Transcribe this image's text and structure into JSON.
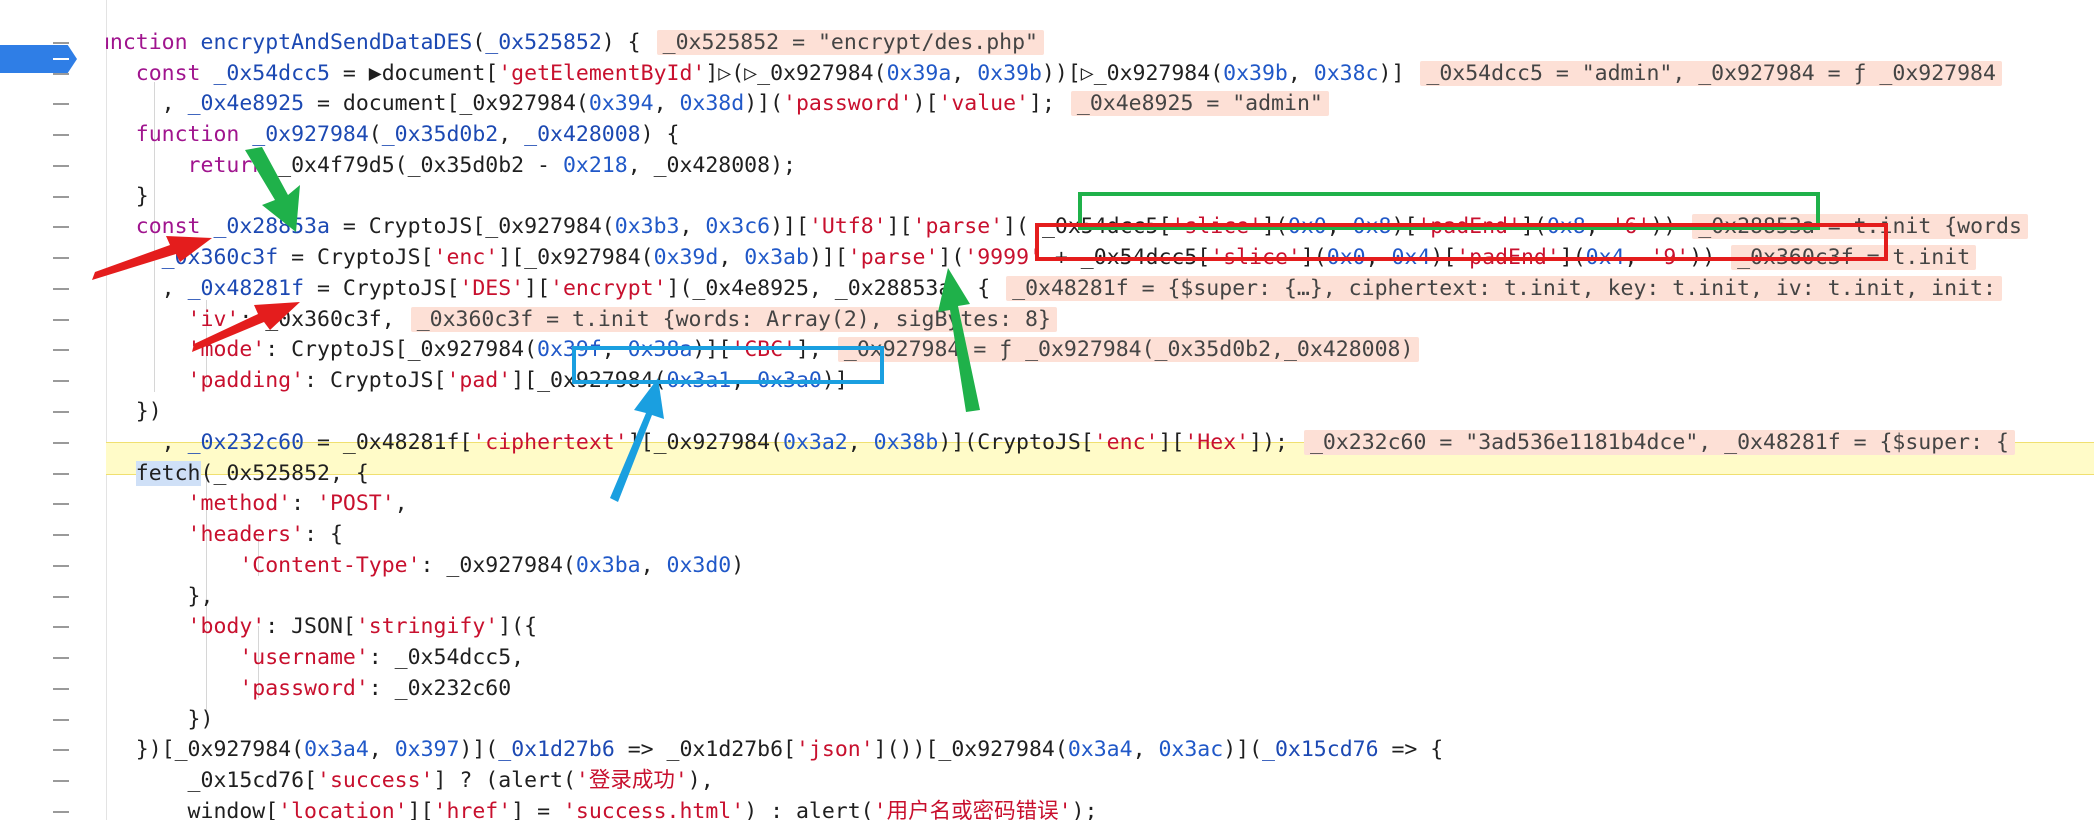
{
  "gutter": {
    "mark": "–"
  },
  "lines": [
    [
      {
        "c": "id",
        "t": "}"
      }
    ],
    [
      {
        "c": "kw",
        "t": "function "
      },
      {
        "c": "fn",
        "t": "encryptAndSendDataDES"
      },
      {
        "c": "pun",
        "t": "("
      },
      {
        "c": "fn",
        "t": "_0x525852"
      },
      {
        "c": "pun",
        "t": ") {"
      },
      {
        "c": "inl",
        "t": "_0x525852 = \"encrypt/des.php\""
      }
    ],
    [
      {
        "c": "kw",
        "t": "    const "
      },
      {
        "c": "fn",
        "t": "_0x54dcc5"
      },
      {
        "c": "pun",
        "t": " = ▶document["
      },
      {
        "c": "str",
        "t": "'getElementById'"
      },
      {
        "c": "pun",
        "t": "]▷(▷_0x927984("
      },
      {
        "c": "num",
        "t": "0x39a"
      },
      {
        "c": "pun",
        "t": ", "
      },
      {
        "c": "num",
        "t": "0x39b"
      },
      {
        "c": "pun",
        "t": "))[▷_0x927984("
      },
      {
        "c": "num",
        "t": "0x39b"
      },
      {
        "c": "pun",
        "t": ", "
      },
      {
        "c": "num",
        "t": "0x38c"
      },
      {
        "c": "pun",
        "t": ")]"
      },
      {
        "c": "inl",
        "t": "_0x54dcc5 = \"admin\", _0x927984 = ƒ _0x927984"
      }
    ],
    [
      {
        "c": "pun",
        "t": "      , "
      },
      {
        "c": "fn",
        "t": "_0x4e8925"
      },
      {
        "c": "pun",
        "t": " = document[_0x927984("
      },
      {
        "c": "num",
        "t": "0x394"
      },
      {
        "c": "pun",
        "t": ", "
      },
      {
        "c": "num",
        "t": "0x38d"
      },
      {
        "c": "pun",
        "t": ")]("
      },
      {
        "c": "str",
        "t": "'password'"
      },
      {
        "c": "pun",
        "t": ")["
      },
      {
        "c": "str",
        "t": "'value'"
      },
      {
        "c": "pun",
        "t": "];"
      },
      {
        "c": "inl",
        "t": "_0x4e8925 = \"admin\""
      }
    ],
    [
      {
        "c": "kw",
        "t": "    function "
      },
      {
        "c": "fn",
        "t": "_0x927984"
      },
      {
        "c": "pun",
        "t": "("
      },
      {
        "c": "fn",
        "t": "_0x35d0b2"
      },
      {
        "c": "pun",
        "t": ", "
      },
      {
        "c": "fn",
        "t": "_0x428008"
      },
      {
        "c": "pun",
        "t": ") {"
      }
    ],
    [
      {
        "c": "kw",
        "t": "        return "
      },
      {
        "c": "pun",
        "t": "_0x4f79d5(_0x35d0b2 - "
      },
      {
        "c": "num",
        "t": "0x218"
      },
      {
        "c": "pun",
        "t": ", _0x428008);"
      }
    ],
    [
      {
        "c": "pun",
        "t": "    }"
      }
    ],
    [
      {
        "c": "kw",
        "t": "    const "
      },
      {
        "c": "fn",
        "t": "_0x28853a"
      },
      {
        "c": "pun",
        "t": " = CryptoJS[_0x927984("
      },
      {
        "c": "num",
        "t": "0x3b3"
      },
      {
        "c": "pun",
        "t": ", "
      },
      {
        "c": "num",
        "t": "0x3c6"
      },
      {
        "c": "pun",
        "t": ")]["
      },
      {
        "c": "str",
        "t": "'Utf8'"
      },
      {
        "c": "pun",
        "t": "]["
      },
      {
        "c": "str",
        "t": "'parse'"
      },
      {
        "c": "pun",
        "t": "]( _0x54dcc5["
      },
      {
        "c": "str",
        "t": "'slice'"
      },
      {
        "c": "pun",
        "t": "]("
      },
      {
        "c": "num",
        "t": "0x0"
      },
      {
        "c": "pun",
        "t": ", "
      },
      {
        "c": "num",
        "t": "0x8"
      },
      {
        "c": "pun",
        "t": ")["
      },
      {
        "c": "str",
        "t": "'padEnd'"
      },
      {
        "c": "pun",
        "t": "]("
      },
      {
        "c": "num",
        "t": "0x8"
      },
      {
        "c": "pun",
        "t": ", "
      },
      {
        "c": "str",
        "t": "'6'"
      },
      {
        "c": "pun",
        "t": "))"
      },
      {
        "c": "inl",
        "t": "_0x28853a = t.init {words"
      }
    ],
    [
      {
        "c": "pun",
        "t": "      "
      },
      {
        "c": "fn",
        "t": "_0x360c3f"
      },
      {
        "c": "pun",
        "t": " = CryptoJS["
      },
      {
        "c": "str",
        "t": "'enc'"
      },
      {
        "c": "pun",
        "t": "][_0x927984("
      },
      {
        "c": "num",
        "t": "0x39d"
      },
      {
        "c": "pun",
        "t": ", "
      },
      {
        "c": "num",
        "t": "0x3ab"
      },
      {
        "c": "pun",
        "t": ")]["
      },
      {
        "c": "str",
        "t": "'parse'"
      },
      {
        "c": "pun",
        "t": "]("
      },
      {
        "c": "str",
        "t": "'9999'"
      },
      {
        "c": "pun",
        "t": " + _0x54dcc5["
      },
      {
        "c": "str",
        "t": "'slice'"
      },
      {
        "c": "pun",
        "t": "]("
      },
      {
        "c": "num",
        "t": "0x0"
      },
      {
        "c": "pun",
        "t": ", "
      },
      {
        "c": "num",
        "t": "0x4"
      },
      {
        "c": "pun",
        "t": ")["
      },
      {
        "c": "str",
        "t": "'padEnd'"
      },
      {
        "c": "pun",
        "t": "]("
      },
      {
        "c": "num",
        "t": "0x4"
      },
      {
        "c": "pun",
        "t": ", "
      },
      {
        "c": "str",
        "t": "'9'"
      },
      {
        "c": "pun",
        "t": "))"
      },
      {
        "c": "inl",
        "t": "_0x360c3f = t.init"
      }
    ],
    [
      {
        "c": "pun",
        "t": "      , "
      },
      {
        "c": "fn",
        "t": "_0x48281f"
      },
      {
        "c": "pun",
        "t": " = CryptoJS["
      },
      {
        "c": "str",
        "t": "'DES'"
      },
      {
        "c": "pun",
        "t": "]["
      },
      {
        "c": "str",
        "t": "'encrypt'"
      },
      {
        "c": "pun",
        "t": "](_0x4e8925, _0x28853a, {"
      },
      {
        "c": "inl",
        "t": "_0x48281f = {$super: {…}, ciphertext: t.init, key: t.init, iv: t.init, init:"
      }
    ],
    [
      {
        "c": "str",
        "t": "        'iv'"
      },
      {
        "c": "pun",
        "t": ": _0x360c3f,"
      },
      {
        "c": "inl",
        "t": "_0x360c3f = t.init {words: Array(2), sigBytes: 8}"
      }
    ],
    [
      {
        "c": "str",
        "t": "        'mode'"
      },
      {
        "c": "pun",
        "t": ": CryptoJS[_0x927984("
      },
      {
        "c": "num",
        "t": "0x39f"
      },
      {
        "c": "pun",
        "t": ", "
      },
      {
        "c": "num",
        "t": "0x38a"
      },
      {
        "c": "pun",
        "t": ")]["
      },
      {
        "c": "str",
        "t": "'CBC'"
      },
      {
        "c": "pun",
        "t": "],"
      },
      {
        "c": "inl",
        "t": "_0x927984 = ƒ _0x927984(_0x35d0b2,_0x428008)"
      }
    ],
    [
      {
        "c": "str",
        "t": "        'padding'"
      },
      {
        "c": "pun",
        "t": ": CryptoJS["
      },
      {
        "c": "str",
        "t": "'pad'"
      },
      {
        "c": "pun",
        "t": "][_0x927984("
      },
      {
        "c": "num",
        "t": "0x3a1"
      },
      {
        "c": "pun",
        "t": ", "
      },
      {
        "c": "num",
        "t": "0x3a0"
      },
      {
        "c": "pun",
        "t": ")]"
      }
    ],
    [
      {
        "c": "pun",
        "t": "    })"
      }
    ],
    [
      {
        "c": "pun",
        "t": "      , "
      },
      {
        "c": "fn",
        "t": "_0x232c60"
      },
      {
        "c": "pun",
        "t": " = _0x48281f["
      },
      {
        "c": "str",
        "t": "'ciphertext'"
      },
      {
        "c": "pun",
        "t": "][_0x927984("
      },
      {
        "c": "num",
        "t": "0x3a2"
      },
      {
        "c": "pun",
        "t": ", "
      },
      {
        "c": "num",
        "t": "0x38b"
      },
      {
        "c": "pun",
        "t": ")](CryptoJS["
      },
      {
        "c": "str",
        "t": "'enc'"
      },
      {
        "c": "pun",
        "t": "]["
      },
      {
        "c": "str",
        "t": "'Hex'"
      },
      {
        "c": "pun",
        "t": "]);"
      },
      {
        "c": "inl",
        "t": "_0x232c60 = \"3ad536e1181b4dce\", _0x48281f = {$super: {"
      }
    ],
    [
      {
        "c": "pun",
        "t": "    "
      },
      {
        "c": "sel",
        "t": "fetch"
      },
      {
        "c": "pun",
        "t": "(_0x525852, {"
      }
    ],
    [
      {
        "c": "str",
        "t": "        'method'"
      },
      {
        "c": "pun",
        "t": ": "
      },
      {
        "c": "str",
        "t": "'POST'"
      },
      {
        "c": "pun",
        "t": ","
      }
    ],
    [
      {
        "c": "str",
        "t": "        'headers'"
      },
      {
        "c": "pun",
        "t": ": {"
      }
    ],
    [
      {
        "c": "str",
        "t": "            'Content-Type'"
      },
      {
        "c": "pun",
        "t": ": _0x927984("
      },
      {
        "c": "num",
        "t": "0x3ba"
      },
      {
        "c": "pun",
        "t": ", "
      },
      {
        "c": "num",
        "t": "0x3d0"
      },
      {
        "c": "pun",
        "t": ")"
      }
    ],
    [
      {
        "c": "pun",
        "t": "        },"
      }
    ],
    [
      {
        "c": "str",
        "t": "        'body'"
      },
      {
        "c": "pun",
        "t": ": JSON["
      },
      {
        "c": "str",
        "t": "'stringify'"
      },
      {
        "c": "pun",
        "t": "]({"
      }
    ],
    [
      {
        "c": "str",
        "t": "            'username'"
      },
      {
        "c": "pun",
        "t": ": _0x54dcc5,"
      }
    ],
    [
      {
        "c": "str",
        "t": "            'password'"
      },
      {
        "c": "pun",
        "t": ": _0x232c60"
      }
    ],
    [
      {
        "c": "pun",
        "t": "        })"
      }
    ],
    [
      {
        "c": "pun",
        "t": "    })[_0x927984("
      },
      {
        "c": "num",
        "t": "0x3a4"
      },
      {
        "c": "pun",
        "t": ", "
      },
      {
        "c": "num",
        "t": "0x397"
      },
      {
        "c": "pun",
        "t": ")]("
      },
      {
        "c": "fn",
        "t": "_0x1d27b6"
      },
      {
        "c": "pun",
        "t": " => _0x1d27b6["
      },
      {
        "c": "str",
        "t": "'json'"
      },
      {
        "c": "pun",
        "t": "]())[_0x927984("
      },
      {
        "c": "num",
        "t": "0x3a4"
      },
      {
        "c": "pun",
        "t": ", "
      },
      {
        "c": "num",
        "t": "0x3ac"
      },
      {
        "c": "pun",
        "t": ")]("
      },
      {
        "c": "fn",
        "t": "_0x15cd76"
      },
      {
        "c": "pun",
        "t": " => {"
      }
    ],
    [
      {
        "c": "pun",
        "t": "        _0x15cd76["
      },
      {
        "c": "str",
        "t": "'success'"
      },
      {
        "c": "pun",
        "t": "] ? (alert("
      },
      {
        "c": "str",
        "t": "'登录成功'"
      },
      {
        "c": "pun",
        "t": "),"
      }
    ],
    [
      {
        "c": "pun",
        "t": "        window["
      },
      {
        "c": "str",
        "t": "'location'"
      },
      {
        "c": "pun",
        "t": "]["
      },
      {
        "c": "str",
        "t": "'href'"
      },
      {
        "c": "pun",
        "t": "] = "
      },
      {
        "c": "str",
        "t": "'success.html'"
      },
      {
        "c": "pun",
        "t": ") : alert("
      },
      {
        "c": "str",
        "t": "'用户名或密码错误'"
      },
      {
        "c": "pun",
        "t": ");"
      }
    ]
  ],
  "annotations": {
    "green_color": "#1fb14a",
    "red_color": "#e41d1d",
    "blue_color": "#1a9fe0"
  }
}
